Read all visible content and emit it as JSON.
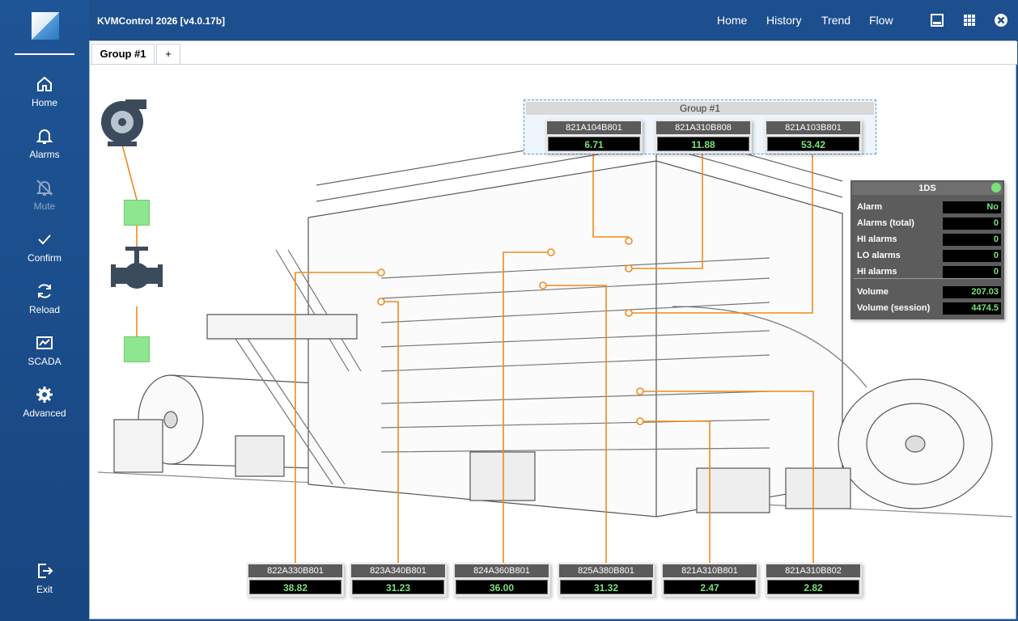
{
  "app": {
    "title": "KVMControl 2026 [v4.0.17b]"
  },
  "topnav": {
    "home": "Home",
    "history": "History",
    "trend": "Trend",
    "flow": "Flow"
  },
  "sidebar": {
    "items": [
      {
        "label": "Home",
        "icon": "home-icon"
      },
      {
        "label": "Alarms",
        "icon": "bell-icon"
      },
      {
        "label": "Mute",
        "icon": "bell-off-icon"
      },
      {
        "label": "Confirm",
        "icon": "check-icon"
      },
      {
        "label": "Reload",
        "icon": "reload-icon"
      },
      {
        "label": "SCADA",
        "icon": "scada-icon"
      },
      {
        "label": "Advanced",
        "icon": "gear-icon"
      }
    ],
    "exit": {
      "label": "Exit",
      "icon": "exit-icon"
    }
  },
  "tabs": {
    "active": "Group #1",
    "add": "+"
  },
  "group": {
    "title": "Group #1",
    "tags": [
      {
        "name": "821A104B801",
        "value": "6.71"
      },
      {
        "name": "821A310B808",
        "value": "11.88"
      },
      {
        "name": "821A103B801",
        "value": "53.42"
      }
    ]
  },
  "bottom_tags": [
    {
      "name": "822A330B801",
      "value": "38.82"
    },
    {
      "name": "823A340B801",
      "value": "31.23"
    },
    {
      "name": "824A360B801",
      "value": "36.00"
    },
    {
      "name": "825A380B801",
      "value": "31.32"
    },
    {
      "name": "821A310B801",
      "value": "2.47"
    },
    {
      "name": "821A310B802",
      "value": "2.82"
    }
  ],
  "status": {
    "title": "1DS",
    "indicator_color": "#7be27b",
    "rows": [
      {
        "label": "Alarm",
        "value": "No"
      },
      {
        "label": "Alarms (total)",
        "value": "0"
      },
      {
        "label": "HI alarms",
        "value": "0"
      },
      {
        "label": "LO alarms",
        "value": "0"
      },
      {
        "label": "HI alarms",
        "value": "0"
      }
    ],
    "volume": [
      {
        "label": "Volume",
        "value": "207.03"
      },
      {
        "label": "Volume (session)",
        "value": "4474.5"
      }
    ]
  },
  "colors": {
    "accent": "#1d4f8f",
    "line": "#f08a1c",
    "value_text": "#7be27b",
    "ok": "#8ee68e"
  }
}
